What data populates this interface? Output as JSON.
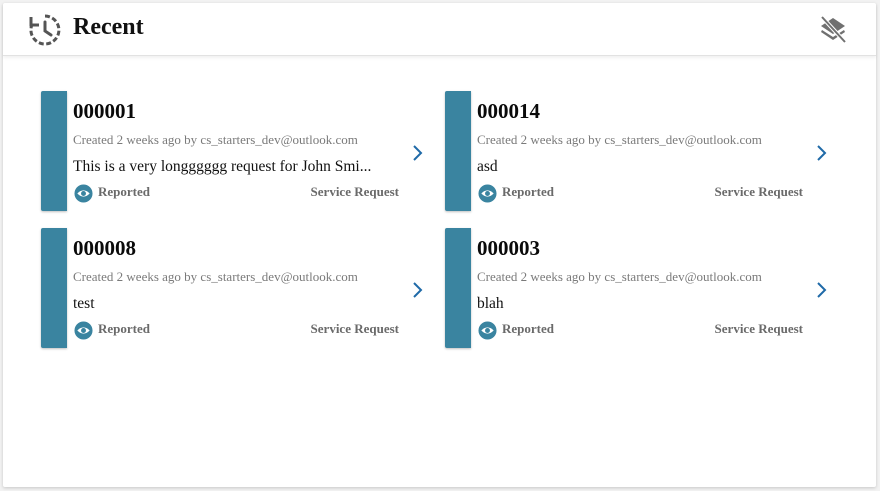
{
  "header": {
    "title": "Recent",
    "icon": "history-icon",
    "action_icon": "layers-clear-icon"
  },
  "colors": {
    "accent": "#3a84a0",
    "chevron": "#1f6aa8"
  },
  "requests": [
    {
      "number": "000001",
      "meta": "Created 2 weeks ago by cs_starters_dev@outlook.com",
      "description": "This is a very longggggg request for John Smi...",
      "status": "Reported",
      "type": "Service Request"
    },
    {
      "number": "000014",
      "meta": "Created 2 weeks ago by cs_starters_dev@outlook.com",
      "description": "asd",
      "status": "Reported",
      "type": "Service Request"
    },
    {
      "number": "000008",
      "meta": "Created 2 weeks ago by cs_starters_dev@outlook.com",
      "description": "test",
      "status": "Reported",
      "type": "Service Request"
    },
    {
      "number": "000003",
      "meta": "Created 2 weeks ago by cs_starters_dev@outlook.com",
      "description": "blah",
      "status": "Reported",
      "type": "Service Request"
    }
  ]
}
